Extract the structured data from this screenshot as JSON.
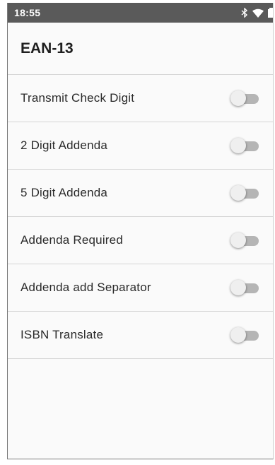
{
  "status_bar": {
    "time": "18:55",
    "icons": [
      "bluetooth-icon",
      "wifi-icon",
      "battery-icon"
    ]
  },
  "app_bar": {
    "title": "EAN-13"
  },
  "settings": [
    {
      "label": "Transmit Check Digit",
      "enabled": false
    },
    {
      "label": "2 Digit Addenda",
      "enabled": false
    },
    {
      "label": "5 Digit Addenda",
      "enabled": false
    },
    {
      "label": "Addenda Required",
      "enabled": false
    },
    {
      "label": "Addenda add Separator",
      "enabled": false
    },
    {
      "label": "ISBN Translate",
      "enabled": false
    }
  ],
  "colors": {
    "status_bar_bg": "#5a5a5a",
    "background": "#fafafa",
    "switch_track_off": "#b5b5b5",
    "switch_thumb_off": "#efefef"
  }
}
